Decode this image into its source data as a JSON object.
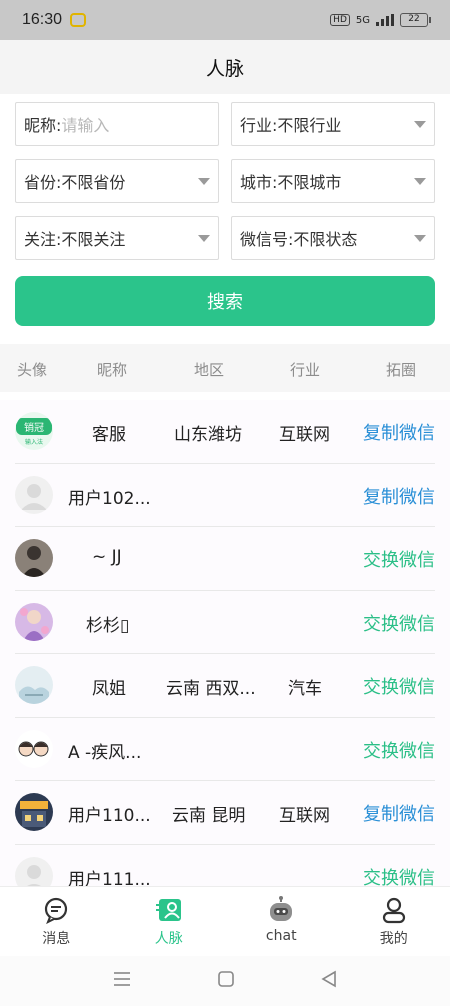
{
  "status_bar": {
    "time": "16:30",
    "hd": "HD",
    "network": "5G",
    "battery": "22"
  },
  "header": {
    "title": "人脉"
  },
  "filters": {
    "nickname_label": "昵称:",
    "nickname_placeholder": "请输入",
    "industry": "行业:不限行业",
    "province": "省份:不限省份",
    "city": "城市:不限城市",
    "follow": "关注:不限关注",
    "wechat": "微信号:不限状态",
    "search_label": "搜索"
  },
  "columns": [
    "头像",
    "昵称",
    "地区",
    "行业",
    "拓圈"
  ],
  "rows": [
    {
      "name": "客服",
      "region": "山东潍坊",
      "industry": "互联网",
      "action": "复制微信",
      "avatar_text": "销冠",
      "avatar_sub": "输入法"
    },
    {
      "name": "用户102...",
      "region": "",
      "industry": "",
      "action": "复制微信"
    },
    {
      "name": "~ JJ",
      "region": "",
      "industry": "",
      "action": "交换微信"
    },
    {
      "name": "杉杉▯",
      "region": "",
      "industry": "",
      "action": "交换微信"
    },
    {
      "name": "凤姐",
      "region": "云南 西双...",
      "industry": "汽车",
      "action": "交换微信"
    },
    {
      "name": "A -疾风...",
      "region": "",
      "industry": "",
      "action": "交换微信"
    },
    {
      "name": "用户110...",
      "region": "云南 昆明",
      "industry": "互联网",
      "action": "复制微信"
    },
    {
      "name": "用户111...",
      "region": "",
      "industry": "",
      "action": "交换微信"
    }
  ],
  "tabs": [
    {
      "label": "消息",
      "icon": "message-icon"
    },
    {
      "label": "人脉",
      "icon": "contacts-icon"
    },
    {
      "label": "chat",
      "icon": "robot-icon"
    },
    {
      "label": "我的",
      "icon": "profile-icon"
    }
  ],
  "colors": {
    "accent": "#2bc48b",
    "copy": "#2a8fd6",
    "swap": "#2bbf87"
  }
}
